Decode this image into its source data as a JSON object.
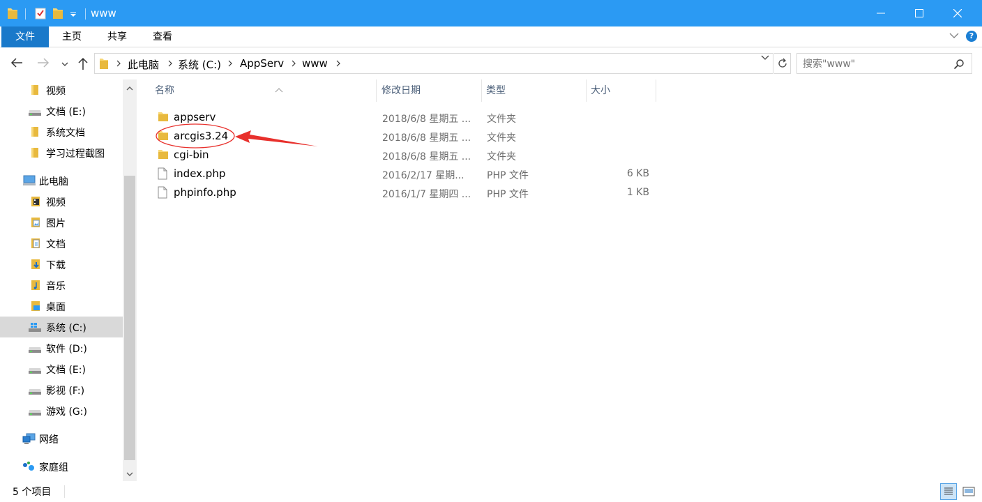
{
  "window": {
    "title": "www",
    "accent": "#2b9af3"
  },
  "ribbon": {
    "tabs": [
      {
        "label": "文件"
      },
      {
        "label": "主页"
      },
      {
        "label": "共享"
      },
      {
        "label": "查看"
      }
    ]
  },
  "address": {
    "crumbs": [
      "此电脑",
      "系统 (C:)",
      "AppServ",
      "www"
    ],
    "search_placeholder": "搜索\"www\""
  },
  "nav": {
    "items": [
      {
        "label": "视频",
        "icon": "folder-icon"
      },
      {
        "label": "文档 (E:)",
        "icon": "drive-icon"
      },
      {
        "label": "系统文档",
        "icon": "folder-icon"
      },
      {
        "label": "学习过程截图",
        "icon": "folder-icon"
      },
      {
        "label": "此电脑",
        "icon": "computer-icon"
      },
      {
        "label": "视频",
        "icon": "videos-folder-icon"
      },
      {
        "label": "图片",
        "icon": "pictures-folder-icon"
      },
      {
        "label": "文档",
        "icon": "documents-folder-icon"
      },
      {
        "label": "下载",
        "icon": "downloads-folder-icon"
      },
      {
        "label": "音乐",
        "icon": "music-folder-icon"
      },
      {
        "label": "桌面",
        "icon": "desktop-folder-icon"
      },
      {
        "label": "系统 (C:)",
        "icon": "windows-drive-icon"
      },
      {
        "label": "软件 (D:)",
        "icon": "drive-icon"
      },
      {
        "label": "文档 (E:)",
        "icon": "drive-icon"
      },
      {
        "label": "影视 (F:)",
        "icon": "drive-icon"
      },
      {
        "label": "游戏 (G:)",
        "icon": "drive-icon"
      },
      {
        "label": "网络",
        "icon": "network-icon"
      },
      {
        "label": "家庭组",
        "icon": "homegroup-icon"
      }
    ]
  },
  "columns": {
    "name": "名称",
    "date": "修改日期",
    "type": "类型",
    "size": "大小"
  },
  "files": [
    {
      "name": "appserv",
      "date": "2018/6/8 星期五 ...",
      "type": "文件夹",
      "size": "",
      "icon": "folder-icon"
    },
    {
      "name": "arcgis3.24",
      "date": "2018/6/8 星期五 ...",
      "type": "文件夹",
      "size": "",
      "icon": "folder-icon"
    },
    {
      "name": "cgi-bin",
      "date": "2018/6/8 星期五 ...",
      "type": "文件夹",
      "size": "",
      "icon": "folder-icon"
    },
    {
      "name": "index.php",
      "date": "2016/2/17 星期...",
      "type": "PHP 文件",
      "size": "6 KB",
      "icon": "file-icon"
    },
    {
      "name": "phpinfo.php",
      "date": "2016/1/7 星期四 ...",
      "type": "PHP 文件",
      "size": "1 KB",
      "icon": "file-icon"
    }
  ],
  "status": {
    "count": "5 个项目"
  },
  "annotation_color": "#e8302c"
}
